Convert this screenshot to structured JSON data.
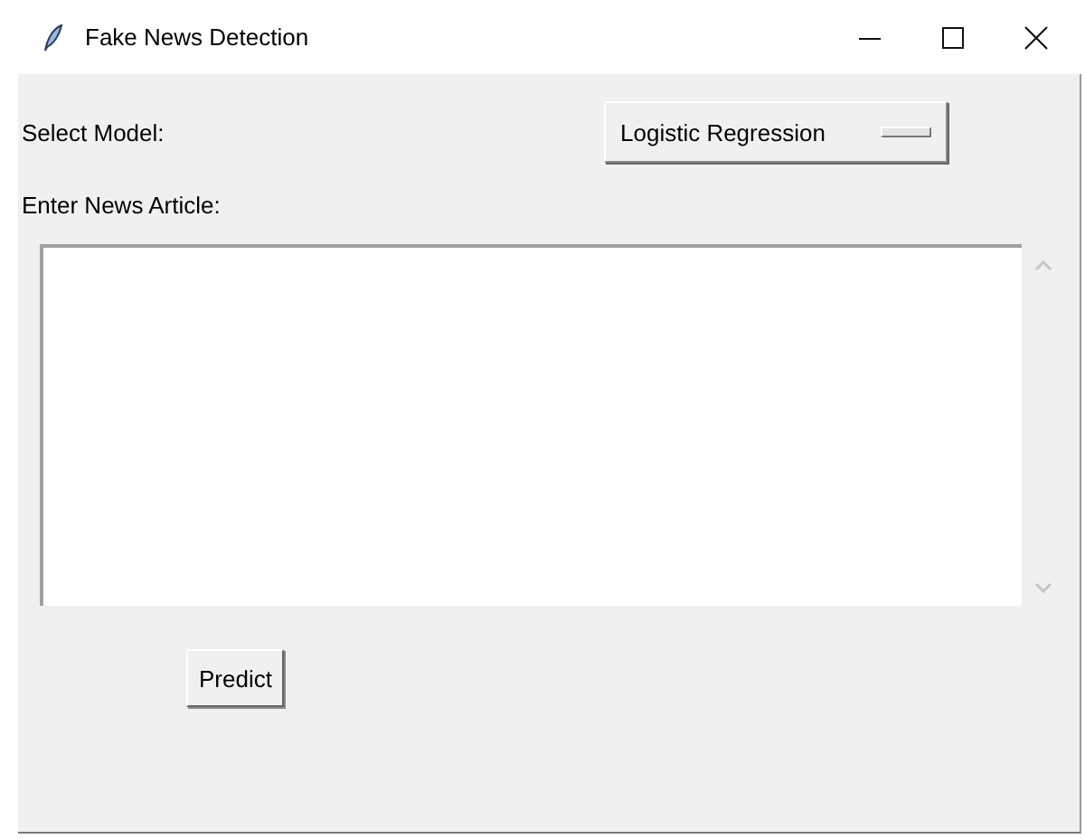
{
  "window": {
    "title": "Fake News Detection"
  },
  "model_select": {
    "label": "Select Model:",
    "value": "Logistic Regression"
  },
  "article": {
    "label": "Enter News Article:"
  },
  "buttons": [
    {
      "label": "Predict"
    }
  ]
}
